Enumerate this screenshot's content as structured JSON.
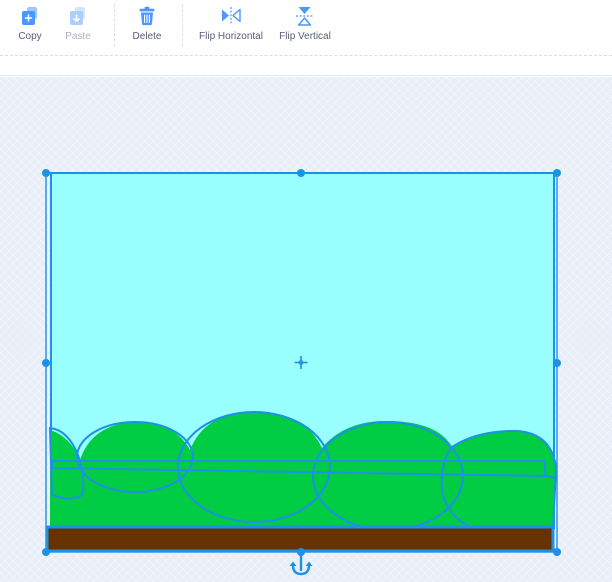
{
  "toolbar": {
    "copy": {
      "label": "Copy",
      "icon": "copy-icon",
      "enabled": true
    },
    "paste": {
      "label": "Paste",
      "icon": "paste-icon",
      "enabled": false
    },
    "delete": {
      "label": "Delete",
      "icon": "trash-icon",
      "enabled": true
    },
    "flip_horizontal": {
      "label": "Flip Horizontal",
      "icon": "flip-horizontal-icon",
      "enabled": true
    },
    "flip_vertical": {
      "label": "Flip Vertical",
      "icon": "flip-vertical-icon",
      "enabled": true
    }
  },
  "canvas": {
    "colors": {
      "sky": "#99ffff",
      "bushes": "#00cc44",
      "ground": "#663300",
      "selection": "#1e90e6"
    },
    "shapes": [
      "sky",
      "bushes",
      "ground"
    ],
    "selection_handles": 8
  },
  "colors": {
    "accent": "#4c97ff",
    "label": "#575e75",
    "disabled_label": "#aeb3c0"
  }
}
